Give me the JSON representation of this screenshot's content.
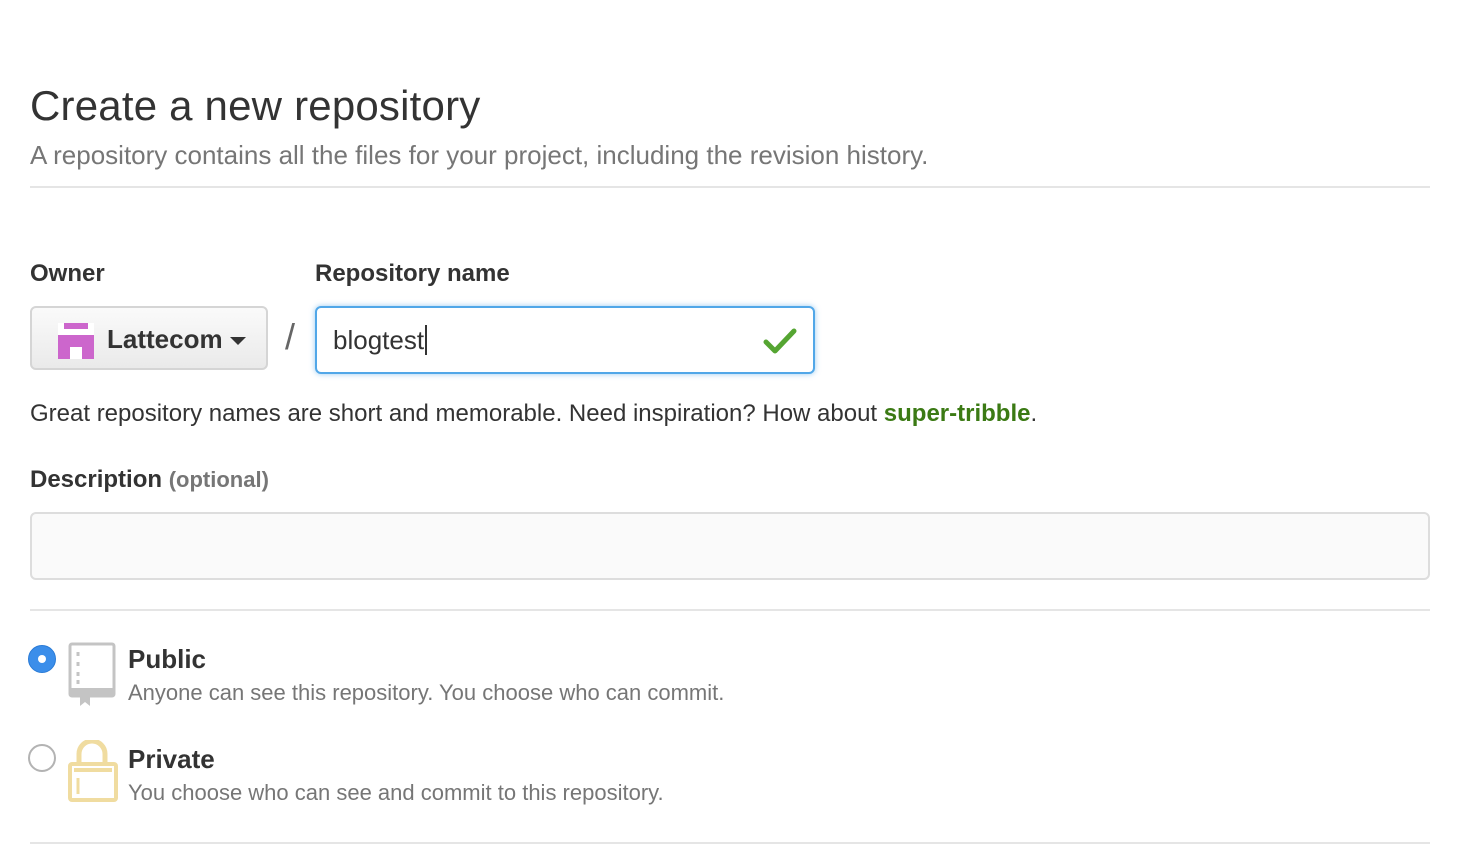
{
  "header": {
    "title": "Create a new repository",
    "subtitle": "A repository contains all the files for your project, including the revision history."
  },
  "owner": {
    "label": "Owner",
    "selected": "Lattecom",
    "avatar_color": "#cc66cc"
  },
  "repo": {
    "label": "Repository name",
    "separator": "/",
    "value": "blogtest",
    "valid_color": "#55a532"
  },
  "hint": {
    "text": "Great repository names are short and memorable. Need inspiration? How about ",
    "suggestion": "super-tribble",
    "suffix": "."
  },
  "description": {
    "label": "Description",
    "optional": "(optional)",
    "value": ""
  },
  "visibility": {
    "public": {
      "title": "Public",
      "desc": "Anyone can see this repository. You choose who can commit.",
      "checked": true
    },
    "private": {
      "title": "Private",
      "desc": "You choose who can see and commit to this repository.",
      "checked": false
    }
  },
  "colors": {
    "focus_border": "#51a7e8",
    "radio_checked": "#3b8eea",
    "suggestion": "#3b7a14",
    "lock_icon": "#f0dca0"
  }
}
